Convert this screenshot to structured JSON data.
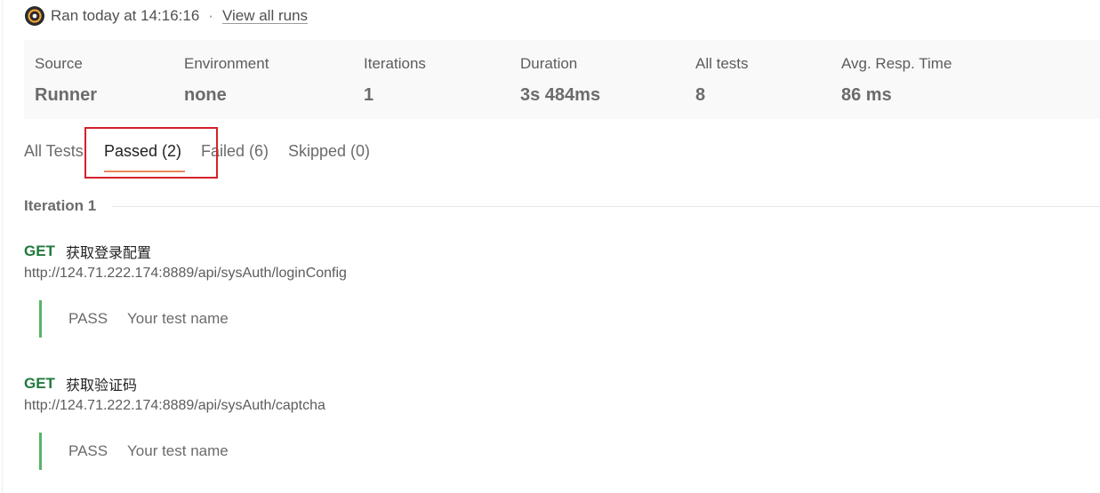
{
  "header": {
    "run_text": "Ran today at 14:16:16",
    "separator": "·",
    "view_all_label": "View all runs"
  },
  "summary": {
    "source": {
      "label": "Source",
      "value": "Runner"
    },
    "environment": {
      "label": "Environment",
      "value": "none"
    },
    "iterations": {
      "label": "Iterations",
      "value": "1"
    },
    "duration": {
      "label": "Duration",
      "value": "3s 484ms"
    },
    "all_tests": {
      "label": "All tests",
      "value": "8"
    },
    "avg_resp": {
      "label": "Avg. Resp. Time",
      "value": "86 ms"
    }
  },
  "tabs": {
    "all": "All Tests",
    "passed": "Passed (2)",
    "failed": "Failed (6)",
    "skipped": "Skipped (0)",
    "active": "passed"
  },
  "iteration": {
    "title": "Iteration 1"
  },
  "requests": [
    {
      "method": "GET",
      "name": "获取登录配置",
      "url": "http://124.71.222.174:8889/api/sysAuth/loginConfig",
      "result": {
        "status": "PASS",
        "test_name": "Your test name"
      }
    },
    {
      "method": "GET",
      "name": "获取验证码",
      "url": "http://124.71.222.174:8889/api/sysAuth/captcha",
      "result": {
        "status": "PASS",
        "test_name": "Your test name"
      }
    }
  ],
  "colors": {
    "method_get": "#1f7a3c",
    "pass_bar": "#58b368",
    "tab_underline": "#e8875c",
    "highlight_box": "#d4202a"
  }
}
